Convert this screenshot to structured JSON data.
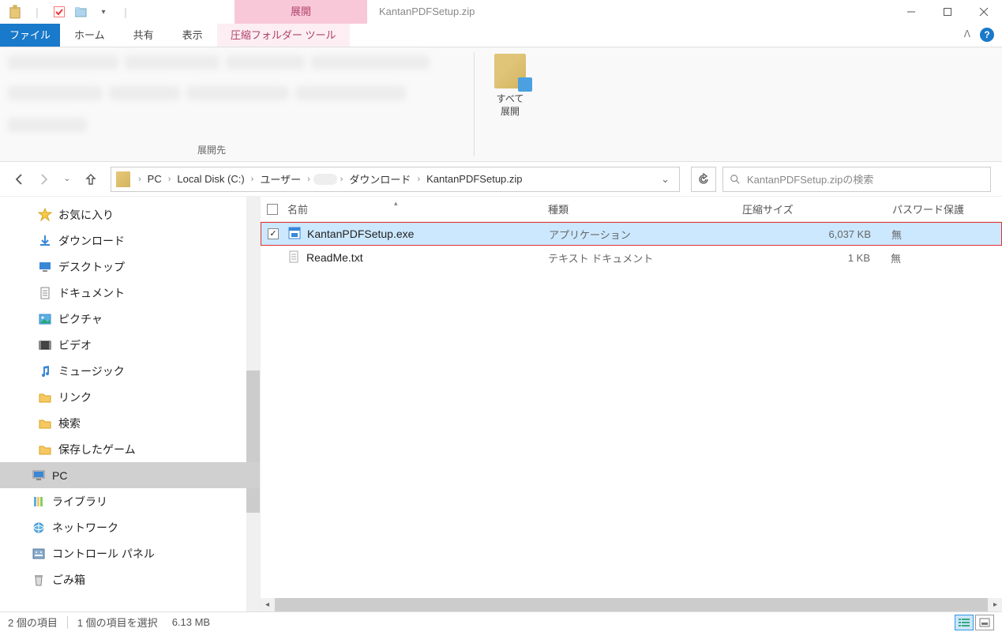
{
  "window": {
    "title": "KantanPDFSetup.zip",
    "contextualTabGroup": "展開",
    "minimize": "−",
    "maximize": "□",
    "close": "✕"
  },
  "qat": {
    "dropdown": "▾"
  },
  "ribbon": {
    "file": "ファイル",
    "tabs": [
      "ホーム",
      "共有",
      "表示"
    ],
    "contextual": "圧縮フォルダー ツール",
    "collapse": "ᐱ",
    "help": "?",
    "extractDestinationLabel": "展開先",
    "extractAll": "すべて\n展開"
  },
  "breadcrumb": {
    "items": [
      "PC",
      "Local Disk (C:)",
      "ユーザー",
      "",
      "ダウンロード",
      "KantanPDFSetup.zip"
    ],
    "sep": "›"
  },
  "search": {
    "placeholder": "KantanPDFSetup.zipの検索"
  },
  "navPane": [
    {
      "label": "お気に入り",
      "icon": "star"
    },
    {
      "label": "ダウンロード",
      "icon": "download"
    },
    {
      "label": "デスクトップ",
      "icon": "desktop"
    },
    {
      "label": "ドキュメント",
      "icon": "document"
    },
    {
      "label": "ピクチャ",
      "icon": "picture"
    },
    {
      "label": "ビデオ",
      "icon": "video"
    },
    {
      "label": "ミュージック",
      "icon": "music"
    },
    {
      "label": "リンク",
      "icon": "folder"
    },
    {
      "label": "検索",
      "icon": "search-folder"
    },
    {
      "label": "保存したゲーム",
      "icon": "folder"
    },
    {
      "label": "PC",
      "icon": "pc",
      "active": true,
      "top": true
    },
    {
      "label": "ライブラリ",
      "icon": "libraries",
      "top": true
    },
    {
      "label": "ネットワーク",
      "icon": "network",
      "top": true
    },
    {
      "label": "コントロール パネル",
      "icon": "control-panel",
      "top": true
    },
    {
      "label": "ごみ箱",
      "icon": "recycle-bin",
      "top": true
    }
  ],
  "columns": {
    "name": "名前",
    "type": "種類",
    "size": "圧縮サイズ",
    "password": "パスワード保護"
  },
  "files": [
    {
      "name": "KantanPDFSetup.exe",
      "type": "アプリケーション",
      "size": "6,037 KB",
      "password": "無",
      "selected": true,
      "checked": true,
      "icon": "exe"
    },
    {
      "name": "ReadMe.txt",
      "type": "テキスト ドキュメント",
      "size": "1 KB",
      "password": "無",
      "selected": false,
      "checked": false,
      "icon": "txt"
    }
  ],
  "status": {
    "count": "2 個の項目",
    "selection": "1 個の項目を選択",
    "size": "6.13 MB"
  }
}
